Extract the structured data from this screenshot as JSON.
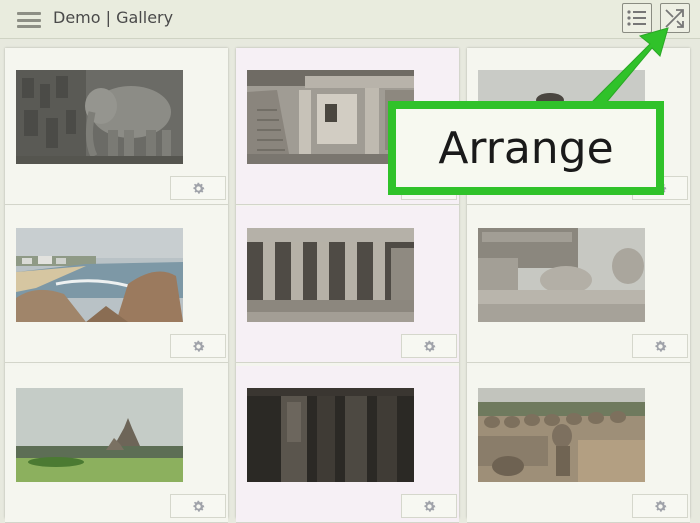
{
  "header": {
    "title": "Demo | Gallery",
    "menu_icon": "hamburger-menu-icon",
    "list_view_icon": "list-view-icon",
    "arrange_icon": "shuffle-arrange-icon"
  },
  "gallery": {
    "columns": [
      {
        "tiles": [
          {
            "image": "elephant rock relief carving",
            "settings_icon": "gear-icon"
          },
          {
            "image": "beach shoreline with boulders",
            "settings_icon": "gear-icon"
          },
          {
            "image": "shore temple on lawn",
            "settings_icon": "gear-icon"
          }
        ]
      },
      {
        "tiles": [
          {
            "image": "rock-cut cave temple facade",
            "settings_icon": "gear-icon"
          },
          {
            "image": "pillared cave mandapa",
            "settings_icon": "gear-icon"
          },
          {
            "image": "dark carved pillars interior",
            "settings_icon": "gear-icon"
          }
        ]
      },
      {
        "tiles": [
          {
            "image": "stone ruins",
            "settings_icon": "gear-icon"
          },
          {
            "image": "carved stone lions and blocks",
            "settings_icon": "gear-icon"
          },
          {
            "image": "row of carved nandi statues",
            "settings_icon": "gear-icon"
          }
        ]
      }
    ]
  },
  "callout": {
    "label": "Arrange",
    "color": "#30c22a"
  },
  "colors": {
    "background": "#e7e9de",
    "accent_green": "#30c22a"
  }
}
